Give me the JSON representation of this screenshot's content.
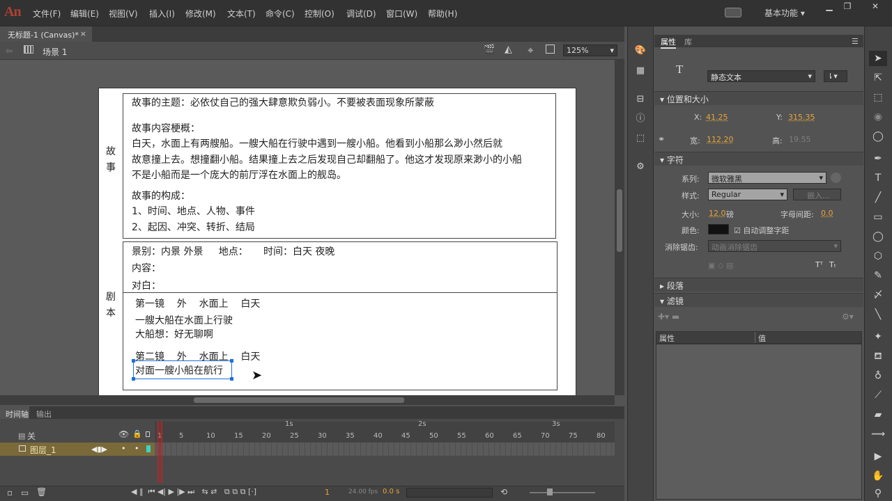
{
  "app": {
    "logo": "An",
    "workspace": "基本功能"
  },
  "menu": [
    "文件(F)",
    "编辑(E)",
    "视图(V)",
    "插入(I)",
    "修改(M)",
    "文本(T)",
    "命令(C)",
    "控制(O)",
    "调试(D)",
    "窗口(W)",
    "帮助(H)"
  ],
  "document_tab": {
    "title": "无标题-1 (Canvas)*",
    "close": "×"
  },
  "editbar": {
    "scene": "场景 1",
    "zoom": "125%"
  },
  "canvas": {
    "story_label": [
      "故",
      "事"
    ],
    "script_label": [
      "剧",
      "本"
    ],
    "story": {
      "theme": "故事的主题：必依仗自己的强大肆意欺负弱小。不要被表面现象所蒙蔽",
      "summary_title": "故事内容梗概：",
      "summary_lines": [
        "白天，水面上有两艘船。一艘大船在行驶中遇到一艘小船。他看到小船那么渺小然后就",
        "故意撞上去。想撞翻小船。结果撞上去之后发现自己却翻船了。他这才发现原来渺小的小船",
        "不是小船而是一个庞大的前厅浮在水面上的舰岛。"
      ],
      "structure_title": "故事的构成：",
      "structure_items": [
        "1、时间、地点、人物、事件",
        "2、起因、冲突、转折、结局"
      ]
    },
    "script": {
      "header_line": "景别：内景 外景     地点：     时间：白天 夜晚",
      "content_label": "内容：",
      "dialog_label": "对白：",
      "shot1_title": "第一镜    外    水面上    白天",
      "shot1_lines": [
        "一艘大船在水面上行驶",
        "大船想：好无聊啊"
      ],
      "shot2_title": "第二镜    外    水面上    白天",
      "shot2_selected": "对面一艘小船在航行"
    }
  },
  "timeline": {
    "tabs": [
      "时间轴",
      "输出"
    ],
    "header_label": "关",
    "layer_name": "图层_1",
    "seconds": [
      "1s",
      "2s",
      "3s"
    ],
    "frame_numbers": [
      "1",
      "5",
      "10",
      "15",
      "20",
      "25",
      "30",
      "35",
      "40",
      "45",
      "50",
      "55",
      "60",
      "65",
      "70",
      "75",
      "80"
    ],
    "current_frame": "1",
    "fps": "24.00 fps",
    "time": "0.0 s"
  },
  "properties": {
    "tabs": [
      "属性",
      "库"
    ],
    "text_type": "静态文本",
    "section_position": "位置和大小",
    "x_label": "X:",
    "x_value": "41.25",
    "y_label": "Y:",
    "y_value": "315.35",
    "w_label": "宽:",
    "w_value": "112.20",
    "h_label": "高:",
    "h_value": "19.55",
    "section_char": "字符",
    "family_label": "系列:",
    "family_value": "微软雅黑",
    "style_label": "样式:",
    "style_value": "Regular",
    "embed_label": "嵌入...",
    "size_label": "大小:",
    "size_value": "12.0",
    "size_unit": "磅",
    "spacing_label": "字母间距:",
    "spacing_value": "0.0",
    "color_label": "颜色:",
    "autokern_label": "自动调整字距",
    "aa_label": "消除锯齿:",
    "aa_value": "动画消除锯齿",
    "section_para": "段落",
    "section_filter": "滤镜",
    "filter_col_prop": "属性",
    "filter_col_val": "值"
  },
  "colors": {
    "accent": "#e8a53a",
    "selection": "#1e6fd9",
    "playhead": "#cc2222",
    "layer_bg": "#7a6a3a"
  }
}
